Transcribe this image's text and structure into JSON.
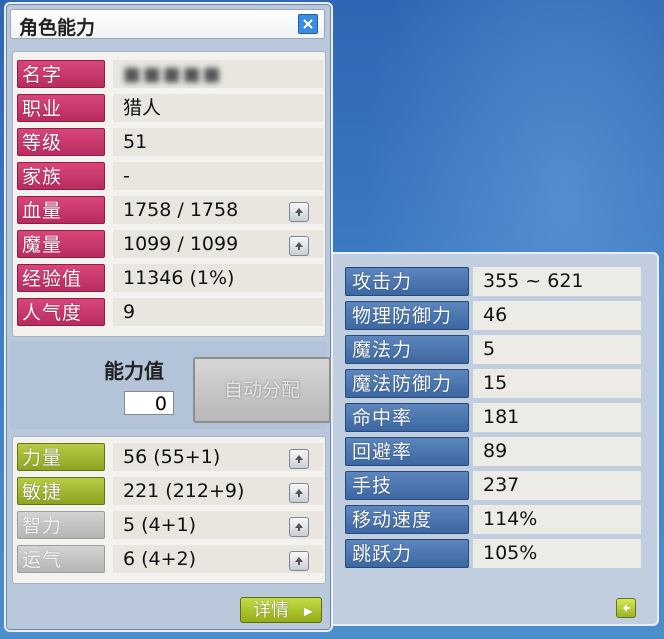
{
  "window": {
    "title": "角色能力"
  },
  "profile": [
    {
      "label": "名字",
      "value": "■■■■■",
      "blurred": true
    },
    {
      "label": "职业",
      "value": "猎人"
    },
    {
      "label": "等级",
      "value": "51"
    },
    {
      "label": "家族",
      "value": "-"
    },
    {
      "label": "血量",
      "value": "1758 / 1758"
    },
    {
      "label": "魔量",
      "value": "1099 / 1099"
    },
    {
      "label": "经验值",
      "value": "11346 (1%)"
    },
    {
      "label": "人气度",
      "value": "9"
    }
  ],
  "ability_points": {
    "label": "能力值",
    "value": "0",
    "auto_assign_label": "自动分配"
  },
  "stats": [
    {
      "label": "力量",
      "value": "56 (55+1)",
      "style": "green"
    },
    {
      "label": "敏捷",
      "value": "221 (212+9)",
      "style": "green"
    },
    {
      "label": "智力",
      "value": "5 (4+1)",
      "style": "grey"
    },
    {
      "label": "运气",
      "value": "6 (4+2)",
      "style": "grey"
    }
  ],
  "detail_button": {
    "label": "详情"
  },
  "details": [
    {
      "label": "攻击力",
      "value": "355 ~ 621"
    },
    {
      "label": "物理防御力",
      "value": "46"
    },
    {
      "label": "魔法力",
      "value": "5"
    },
    {
      "label": "魔法防御力",
      "value": "15"
    },
    {
      "label": "命中率",
      "value": "181"
    },
    {
      "label": "回避率",
      "value": "89"
    },
    {
      "label": "手技",
      "value": "237"
    },
    {
      "label": "移动速度",
      "value": "114%"
    },
    {
      "label": "跳跃力",
      "value": "105%"
    }
  ],
  "colors": {
    "profile_label": "#c83a6e",
    "stat_label_active": "#a3b930",
    "stat_label_inactive": "#c4c4c4",
    "detail_label": "#4a76b0",
    "background_sky": "#3d7cc4"
  },
  "icons": {
    "close": "close-icon",
    "stat_up": "arrow-up-icon",
    "detail": "chevron-right-icon",
    "back": "arrow-left-icon"
  }
}
